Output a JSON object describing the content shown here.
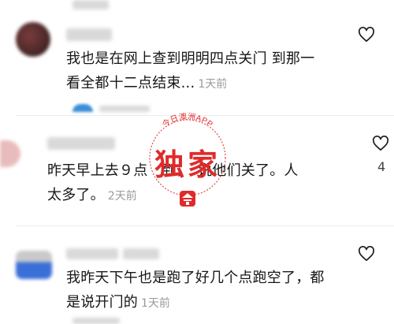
{
  "comments": [
    {
      "text_line1": "我也是在网上查到明明四点关门 到那一",
      "text_line2": "看全都十二点结束...",
      "time": "1天前"
    },
    {
      "text_line1": "昨天早上去９点　到，　说他们关了。人",
      "text_line2": "太多了。",
      "time": "2天前",
      "like_count": "4"
    },
    {
      "text_line1": "我昨天下午也是跑了好几个点跑空了，都",
      "text_line2": "是说开门的",
      "time": "1天前"
    }
  ],
  "watermark": {
    "brand": "今日澳洲APP",
    "big_text": "独家",
    "color": "#e02a2a"
  },
  "icons": {
    "like": "heart-outline-icon"
  }
}
